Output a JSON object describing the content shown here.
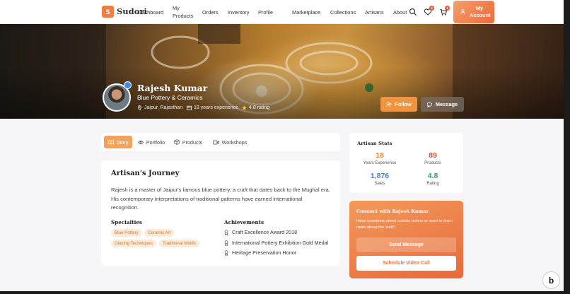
{
  "nav": {
    "logo_letter": "S",
    "brand": "Sudori",
    "links": {
      "dashboard": "Dashboard",
      "my_products_line1": "My",
      "my_products_line2": "Products",
      "orders": "Orders",
      "inventory": "Inventory",
      "profile": "Profile",
      "marketplace": "Marketplace",
      "collections": "Collections",
      "artisans": "Artisans",
      "about": "About"
    },
    "wishlist_count": "2",
    "cart_count": "3",
    "account_line1": "My",
    "account_line2": "Account"
  },
  "hero": {
    "name": "Rajesh Kumar",
    "craft": "Blue Pottery & Ceramics",
    "location": "Jaipur, Rajasthan",
    "experience": "18 years experience",
    "rating": "4.8 rating",
    "follow_label": "Follow",
    "message_label": "Message"
  },
  "tabs": [
    {
      "label": "Story"
    },
    {
      "label": "Portfolio"
    },
    {
      "label": "Products"
    },
    {
      "label": "Workshops"
    }
  ],
  "story": {
    "title": "Artisan's Journey",
    "body": "Rajesh is a master of Jaipur's famous blue pottery, a craft that dates back to the Mughal era. His contemporary interpretations of traditional patterns have earned international recognition.",
    "specialties_heading": "Specialties",
    "specialties": [
      "Blue Pottery",
      "Ceramic Art",
      "Glazing Techniques",
      "Traditional Motifs"
    ],
    "achievements_heading": "Achievements",
    "achievements": [
      "Craft Excellence Award 2018",
      "International Pottery Exhibition Gold Medal",
      "Heritage Preservation Honor"
    ]
  },
  "stats": {
    "title": "Artisan Stats",
    "items": [
      {
        "value": "18",
        "label": "Years Experience",
        "color": "#e98a3b"
      },
      {
        "value": "89",
        "label": "Products",
        "color": "#d0553a"
      },
      {
        "value": "1,876",
        "label": "Sales",
        "color": "#3f7fd8"
      },
      {
        "value": "4.8",
        "label": "Rating",
        "color": "#3aa05a"
      }
    ]
  },
  "connect": {
    "title": "Connect with Rajesh Kumar",
    "text": "Have questions about custom orders or want to learn more about the craft?",
    "send_label": "Send Message",
    "video_label": "Schedule Video Call"
  },
  "colors": {
    "accent": "#ee7e43",
    "tab_active": "#f0a45c",
    "chip_bg": "#fbecd9",
    "chip_text": "#c87532"
  }
}
